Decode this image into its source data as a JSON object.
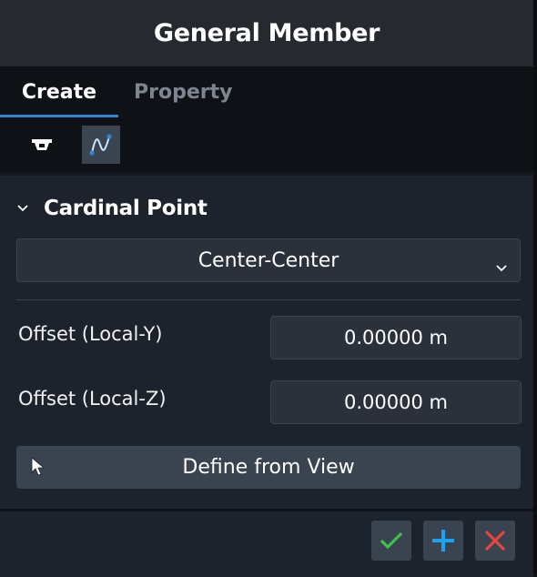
{
  "header": {
    "title": "General Member"
  },
  "tabs": [
    {
      "label": "Create",
      "active": true
    },
    {
      "label": "Property",
      "active": false
    }
  ],
  "toolbar": {
    "tools": [
      {
        "icon": "section-shape-icon",
        "active": false
      },
      {
        "icon": "curve-member-icon",
        "active": true
      }
    ]
  },
  "cardinal_point": {
    "section_title": "Cardinal Point",
    "selected": "Center-Center",
    "fields": [
      {
        "label": "Offset (Local-Y)",
        "value": "0.00000 m"
      },
      {
        "label": "Offset (Local-Z)",
        "value": "0.00000 m"
      }
    ],
    "define_button": "Define from View"
  },
  "footer": {
    "ok_icon": "checkmark-icon",
    "add_icon": "plus-icon",
    "cancel_icon": "x-icon"
  },
  "colors": {
    "accent": "#2f86d6",
    "ok": "#3cc44a",
    "add": "#1aa3f0",
    "cancel": "#e8453c"
  }
}
